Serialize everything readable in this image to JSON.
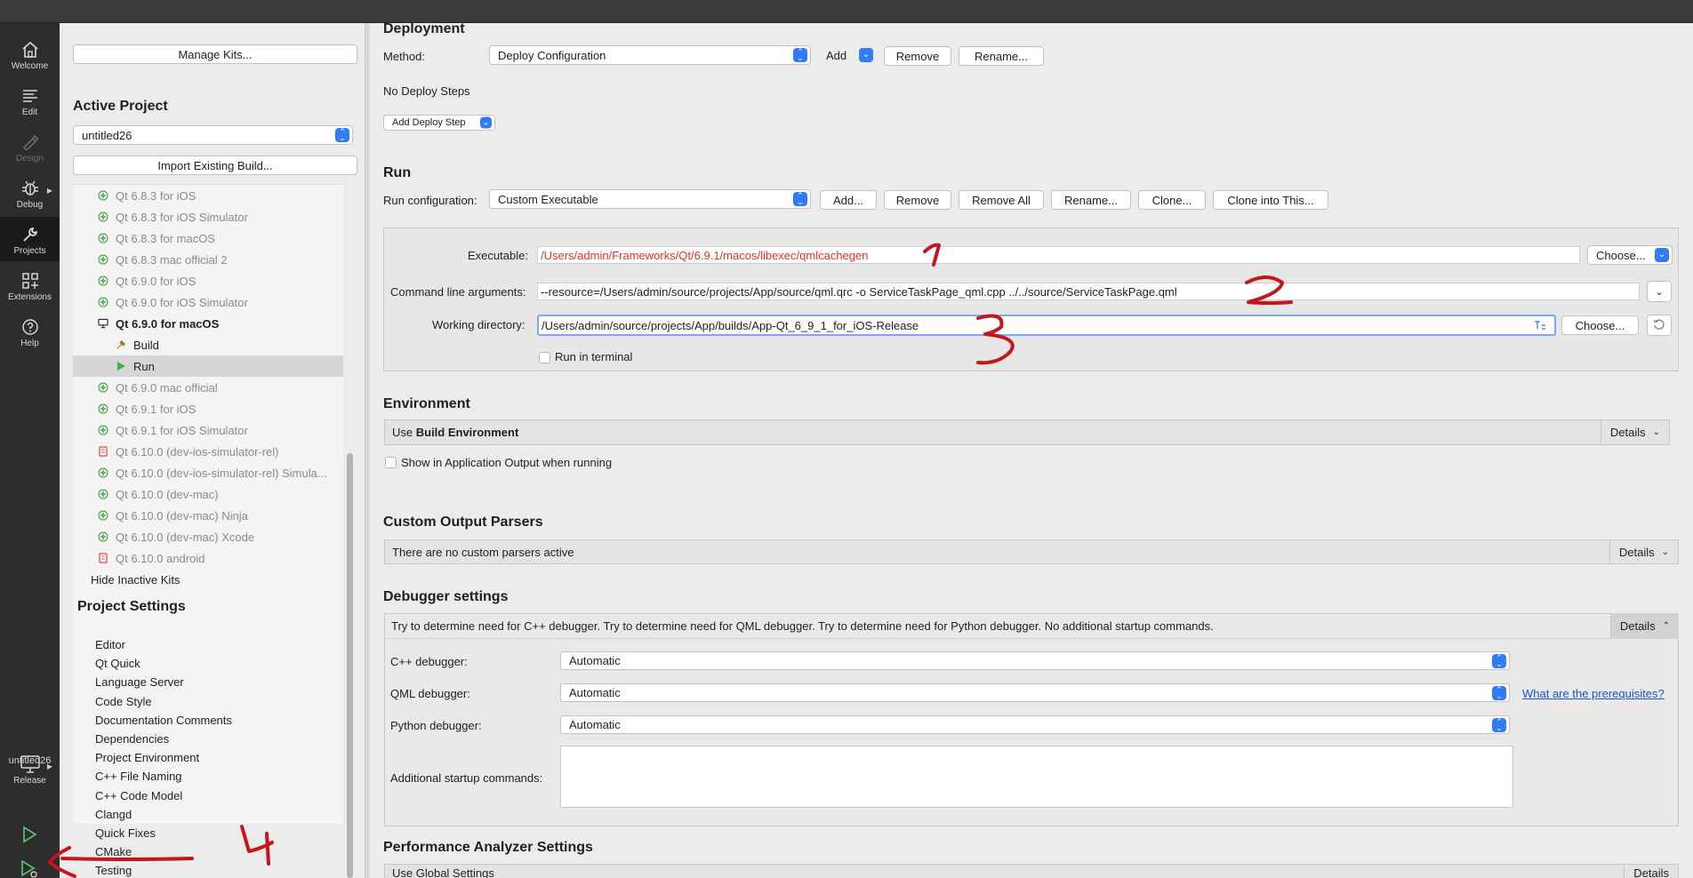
{
  "modebar": {
    "items": [
      {
        "label": "Welcome",
        "icon": "home-icon"
      },
      {
        "label": "Edit",
        "icon": "edit-icon"
      },
      {
        "label": "Design",
        "icon": "design-icon"
      },
      {
        "label": "Debug",
        "icon": "bug-icon"
      },
      {
        "label": "Projects",
        "icon": "wrench-icon"
      },
      {
        "label": "Extensions",
        "icon": "extensions-icon"
      },
      {
        "label": "Help",
        "icon": "help-icon"
      }
    ],
    "project_name": "untitled26",
    "build_mode": "Release"
  },
  "left": {
    "manage_kits": "Manage Kits...",
    "active_project_title": "Active Project",
    "active_project_value": "untitled26",
    "import_build": "Import Existing Build...",
    "kits": [
      "Qt 6.8.3 for iOS",
      "Qt 6.8.3 for iOS Simulator",
      "Qt 6.8.3 for macOS",
      "Qt 6.8.3 mac official 2",
      "Qt 6.9.0 for iOS",
      "Qt 6.9.0 for iOS Simulator",
      "Qt 6.9.0 for macOS",
      "Build",
      "Run",
      "Qt 6.9.0 mac official",
      "Qt 6.9.1 for iOS",
      "Qt 6.9.1 for iOS Simulator",
      "Qt 6.10.0 (dev-ios-simulator-rel)",
      "Qt 6.10.0 (dev-ios-simulator-rel) Simula...",
      "Qt 6.10.0 (dev-mac)",
      "Qt 6.10.0 (dev-mac) Ninja",
      "Qt 6.10.0 (dev-mac) Xcode",
      "Qt 6.10.0 android",
      "Hide Inactive Kits"
    ],
    "project_settings_title": "Project Settings",
    "settings": [
      "Editor",
      "Qt Quick",
      "Language Server",
      "Code Style",
      "Documentation Comments",
      "Dependencies",
      "Project Environment",
      "C++ File Naming",
      "C++ Code Model",
      "Clangd",
      "Quick Fixes",
      "CMake",
      "Testing"
    ]
  },
  "deployment": {
    "title": "Deployment",
    "method_label": "Method:",
    "method_value": "Deploy Configuration",
    "add": "Add",
    "remove": "Remove",
    "rename": "Rename...",
    "no_steps": "No Deploy Steps",
    "add_step": "Add Deploy Step"
  },
  "run": {
    "title": "Run",
    "config_label": "Run configuration:",
    "config_value": "Custom Executable",
    "add": "Add...",
    "remove": "Remove",
    "remove_all": "Remove All",
    "rename": "Rename...",
    "clone": "Clone...",
    "clone_into": "Clone into This...",
    "executable_label": "Executable:",
    "executable_value": "/Users/admin/Frameworks/Qt/6.9.1/macos/libexec/qmlcachegen",
    "choose": "Choose...",
    "args_label": "Command line arguments:",
    "args_value": "--resource=/Users/admin/source/projects/App/source/qml.qrc -o ServiceTaskPage_qml.cpp ../../source/ServiceTaskPage.qml",
    "workdir_label": "Working directory:",
    "workdir_value": "/Users/admin/source/projects/App/builds/App-Qt_6_9_1_for_iOS-Release",
    "run_in_terminal": "Run in terminal"
  },
  "environment": {
    "title": "Environment",
    "use_prefix": "Use ",
    "use_bold": "Build Environment",
    "details": "Details",
    "show_output": "Show in Application Output when running"
  },
  "parsers": {
    "title": "Custom Output Parsers",
    "summary": "There are no custom parsers active",
    "details": "Details"
  },
  "debugger": {
    "title": "Debugger settings",
    "summary": "Try to determine need for C++ debugger. Try to determine need for QML debugger. Try to determine need for Python debugger. No additional startup commands.",
    "details": "Details",
    "cpp_label": "C++ debugger:",
    "cpp_value": "Automatic",
    "qml_label": "QML debugger:",
    "qml_value": "Automatic",
    "prereq_link": "What are the prerequisites?",
    "python_label": "Python debugger:",
    "python_value": "Automatic",
    "startup_label": "Additional startup commands:"
  },
  "perf": {
    "title": "Performance Analyzer Settings",
    "partial": "Use Global Settings",
    "details": "Details"
  },
  "colors": {
    "accent": "#2f7cf6",
    "annotation": "#c4161c",
    "error_text": "#e0322b"
  }
}
